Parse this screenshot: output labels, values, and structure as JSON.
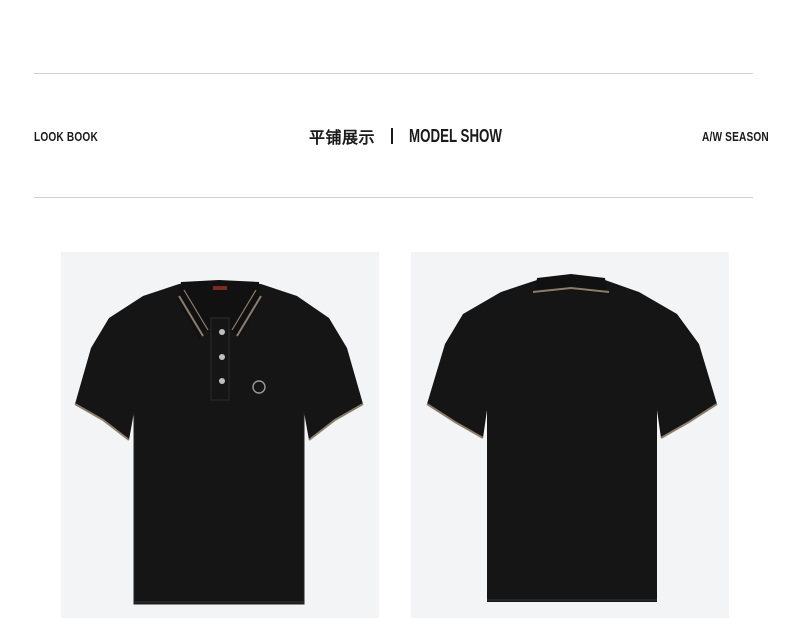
{
  "header": {
    "left_label": "LOOK BOOK",
    "center_cn": "平铺展示",
    "center_en": "MODEL SHOW",
    "right_label": "A/W SEASON"
  },
  "products": [
    {
      "view": "front",
      "icon": "polo-shirt-front-icon"
    },
    {
      "view": "back",
      "icon": "polo-shirt-back-icon"
    }
  ],
  "colors": {
    "shirt": "#151515",
    "trim": "#8a7e6a",
    "photo_bg": "#f3f4f6",
    "rule": "#cfcfcf"
  }
}
